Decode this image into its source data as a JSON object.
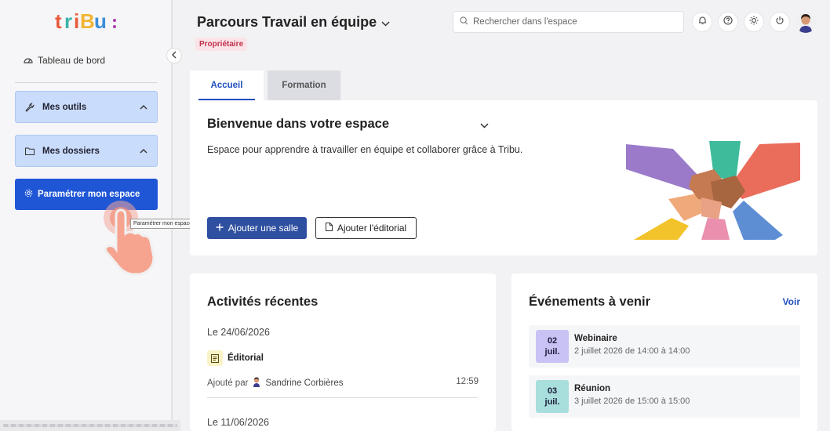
{
  "sidebar": {
    "logo_text": "tribu:",
    "dashboard": "Tableau de bord",
    "groups": [
      {
        "label": "Mes outils"
      },
      {
        "label": "Mes dossiers"
      }
    ],
    "configure": "Paramétrer mon espace",
    "tooltip": "Paramétrer mon espace"
  },
  "header": {
    "title": "Parcours Travail en équipe",
    "badge": "Propriétaire",
    "search_placeholder": "Rechercher dans l'espace"
  },
  "tabs": [
    {
      "label": "Accueil",
      "active": true
    },
    {
      "label": "Formation",
      "active": false
    }
  ],
  "welcome": {
    "title": "Bienvenue dans votre espace",
    "description": "Espace pour apprendre à travailler en équipe et collaborer grâce à Tribu.",
    "add_room": "Ajouter une salle",
    "add_editorial": "Ajouter l'éditorial"
  },
  "activities": {
    "title": "Activités récentes",
    "groups": [
      {
        "date": "Le 24/06/2026",
        "type": "Éditorial",
        "added_by_label": "Ajouté par",
        "author": "Sandrine Corbières",
        "time": "12:59"
      },
      {
        "date": "Le 11/06/2026"
      }
    ]
  },
  "events": {
    "title": "Événements à venir",
    "see_all": "Voir",
    "items": [
      {
        "day": "02",
        "month": "juil.",
        "name": "Webinaire",
        "when": "2 juillet 2026 de 14:00 à 14:00",
        "color": "#c9c2f5"
      },
      {
        "day": "03",
        "month": "juil.",
        "name": "Réunion",
        "when": "3 juillet 2026 de 15:00 à 15:00",
        "color": "#a8dfdc"
      }
    ]
  },
  "colors": {
    "primary": "#1f56d6",
    "group_bg": "#c9dcfb",
    "badge_text": "#c0304a"
  }
}
